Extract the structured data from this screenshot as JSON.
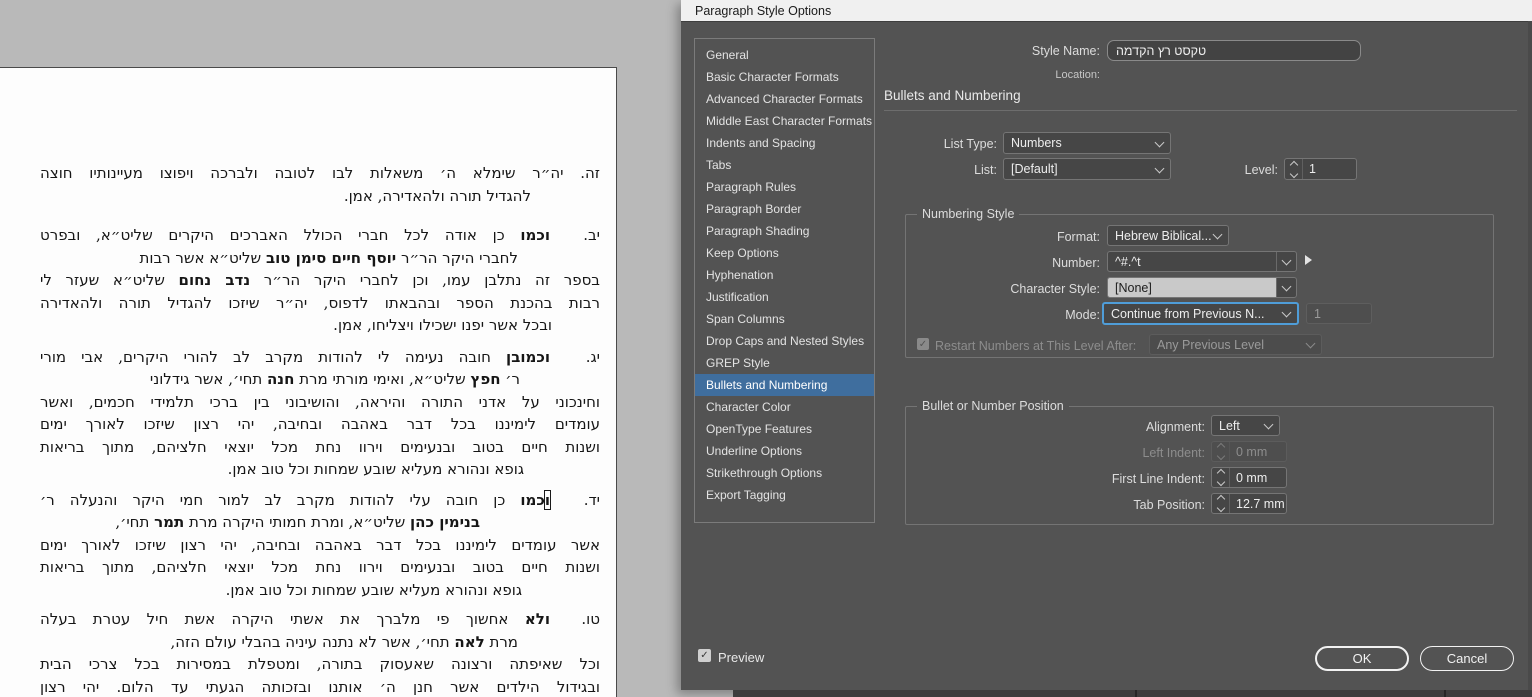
{
  "colors": {
    "dialog_bg": "#535353",
    "titlebar_bg": "#f0f0f0",
    "selection_blue": "#3f6e9e",
    "focus_blue": "#4f9dd8",
    "pasteboard_gray": "#b9b9b9",
    "page_white": "#fdfdfd"
  },
  "dialog": {
    "title": "Paragraph Style Options",
    "style_name_label": "Style Name:",
    "style_name_value": "טקסט רץ הקדמה",
    "location_label": "Location:",
    "section_title": "Bullets and Numbering",
    "sidebar": {
      "selected": "Bullets and Numbering",
      "items": [
        "General",
        "Basic Character Formats",
        "Advanced Character Formats",
        "Middle East Character Formats",
        "Indents and Spacing",
        "Tabs",
        "Paragraph Rules",
        "Paragraph Border",
        "Paragraph Shading",
        "Keep Options",
        "Hyphenation",
        "Justification",
        "Span Columns",
        "Drop Caps and Nested Styles",
        "GREP Style",
        "Bullets and Numbering",
        "Character Color",
        "OpenType Features",
        "Underline Options",
        "Strikethrough Options",
        "Export Tagging"
      ]
    },
    "fields": {
      "list_type_label": "List Type:",
      "list_type_value": "Numbers",
      "list_label": "List:",
      "list_value": "[Default]",
      "level_label": "Level:",
      "level_value": "1",
      "numbering_style": {
        "group_label": "Numbering Style",
        "format_label": "Format:",
        "format_value": "Hebrew Biblical...",
        "number_label": "Number:",
        "number_value": "^#.^t",
        "character_style_label": "Character Style:",
        "character_style_value": "[None]",
        "mode_label": "Mode:",
        "mode_value": "Continue from Previous N...",
        "mode_number_value": "1",
        "restart_label": "Restart Numbers at This Level After:",
        "restart_checked": true,
        "restart_value": "Any Previous Level"
      },
      "position": {
        "group_label": "Bullet or Number Position",
        "alignment_label": "Alignment:",
        "alignment_value": "Left",
        "left_indent_label": "Left Indent:",
        "left_indent_value": "0 mm",
        "first_line_indent_label": "First Line Indent:",
        "first_line_indent_value": "0 mm",
        "tab_position_label": "Tab Position:",
        "tab_position_value": "12.7 mm"
      }
    },
    "preview_label": "Preview",
    "preview_checked": true,
    "ok_label": "OK",
    "cancel_label": "Cancel"
  },
  "document": {
    "paragraphs": [
      {
        "gap_after": 17,
        "lines": [
          {
            "justify": true,
            "segments": [
              {
                "t": "זה. יה״ר שימלא ה׳ משאלות לבו לטובה ולברכה ויפוצו מעיינותיו חוצה"
              }
            ]
          },
          {
            "justify": false,
            "indent_right": 69,
            "segments": [
              {
                "t": "להגדיל תורה ולהאדירה, אמן."
              }
            ]
          }
        ]
      },
      {
        "gap_after": 9,
        "lines": [
          {
            "justify": true,
            "segments": [
              {
                "t": "יב.",
                "num": true
              },
              {
                "t": "וכמו",
                "b": true
              },
              {
                "t": " כן אודה לכל חברי הכולל האברכים היקרים שליט״א, ובפרט"
              }
            ]
          },
          {
            "justify": false,
            "indent_right": 82,
            "segments": [
              {
                "t": "לחברי היקר הר״ר "
              },
              {
                "t": "יוסף חיים סימן טוב",
                "b": true
              },
              {
                "t": " שליט״א אשר רבות"
              }
            ]
          },
          {
            "justify": true,
            "segments": [
              {
                "t": "בספר זה נתלבן עמו, וכן לחברי היקר הר״ר "
              },
              {
                "t": "נדב נחום",
                "b": true
              },
              {
                "t": " שליט״א שעזר לי"
              }
            ]
          },
          {
            "justify": true,
            "segments": [
              {
                "t": "רבות בהכנת הספר ובהבאתו לדפוס, יה״ר שיזכו להגדיל תורה ולהאדירה"
              }
            ]
          },
          {
            "justify": false,
            "indent_right": 48,
            "segments": [
              {
                "t": "ובכל אשר יפנו ישכילו ויצליחו, אמן."
              }
            ]
          }
        ]
      },
      {
        "gap_after": 8,
        "lines": [
          {
            "justify": true,
            "segments": [
              {
                "t": "יג.",
                "num": true
              },
              {
                "t": "וכמובן",
                "b": true
              },
              {
                "t": " חובה נעימה לי להודות מקרב לב להורי היקרים, אבי מורי"
              }
            ]
          },
          {
            "justify": false,
            "indent_right": 80,
            "segments": [
              {
                "t": "ר׳ "
              },
              {
                "t": "חפץ",
                "b": true
              },
              {
                "t": " שליט״א, ואימי מורתי מרת "
              },
              {
                "t": "חנה",
                "b": true
              },
              {
                "t": " תחי׳, אשר גידלוני"
              }
            ]
          },
          {
            "justify": true,
            "segments": [
              {
                "t": "וחינכוני על אדני התורה והיראה, והושיבוני בין ברכי תלמידי חכמים, ואשר"
              }
            ]
          },
          {
            "justify": true,
            "segments": [
              {
                "t": "עומדים לימיננו בכל דבר באהבה ובחיבה, יהי רצון שיזכו לאורך ימים"
              }
            ]
          },
          {
            "justify": true,
            "segments": [
              {
                "t": "ושנות חיים בטוב ובנעימים וירוו נחת מכל יוצאי חלציהם, מתוך בריאות"
              }
            ]
          },
          {
            "justify": false,
            "indent_right": 76,
            "segments": [
              {
                "t": "גופא ונהורא מעליא שובע שמחות וכל טוב אמן."
              }
            ]
          }
        ]
      },
      {
        "gap_after": 7,
        "lines": [
          {
            "justify": true,
            "segments": [
              {
                "t": "יד.",
                "num": true
              },
              {
                "t": "ו",
                "b": true,
                "sel": true
              },
              {
                "t": "כמו",
                "b": true
              },
              {
                "t": " כן חובה עלי להודות מקרב לב למור חמי היקר והנעלה ר׳"
              }
            ]
          },
          {
            "justify": false,
            "indent_right": 120,
            "segments": [
              {
                "t": "בנימין כהן",
                "b": true
              },
              {
                "t": " שליט״א, ומרת חמותי היקרה מרת "
              },
              {
                "t": "תמר",
                "b": true
              },
              {
                "t": " תחי׳,"
              }
            ]
          },
          {
            "justify": true,
            "segments": [
              {
                "t": "אשר עומדים לימיננו בכל דבר באהבה ובחיבה, יהי רצון שיזכו לאורך ימים"
              }
            ]
          },
          {
            "justify": true,
            "segments": [
              {
                "t": "ושנות חיים בטוב ובנעימים וירוו נחת מכל יוצאי חלציהם, מתוך בריאות"
              }
            ]
          },
          {
            "justify": false,
            "indent_right": 78,
            "segments": [
              {
                "t": "גופא ונהורא מעליא שובע שמחות וכל טוב אמן."
              }
            ]
          }
        ]
      },
      {
        "gap_after": 0,
        "lines": [
          {
            "justify": true,
            "segments": [
              {
                "t": "טו.",
                "num": true
              },
              {
                "t": "ולא",
                "b": true
              },
              {
                "t": " אחשוך פי מלברך את אשתי היקרה אשת חיל עטרת בעלה"
              }
            ]
          },
          {
            "justify": false,
            "indent_right": 82,
            "segments": [
              {
                "t": "מרת "
              },
              {
                "t": "לאה",
                "b": true
              },
              {
                "t": " תחי׳, אשר לא נתנה עיניה בהבלי עולם הזה,"
              }
            ]
          },
          {
            "justify": true,
            "segments": [
              {
                "t": "וכל שאיפתה ורצונה שאעסוק בתורה, ומטפלת במסירות בכל צרכי הבית"
              }
            ]
          },
          {
            "justify": true,
            "segments": [
              {
                "t": "ובגידול הילדים אשר חנן ה׳ אותנו ובזכותה הגעתי עד הלום. יהי רצון"
              }
            ]
          }
        ]
      }
    ]
  }
}
